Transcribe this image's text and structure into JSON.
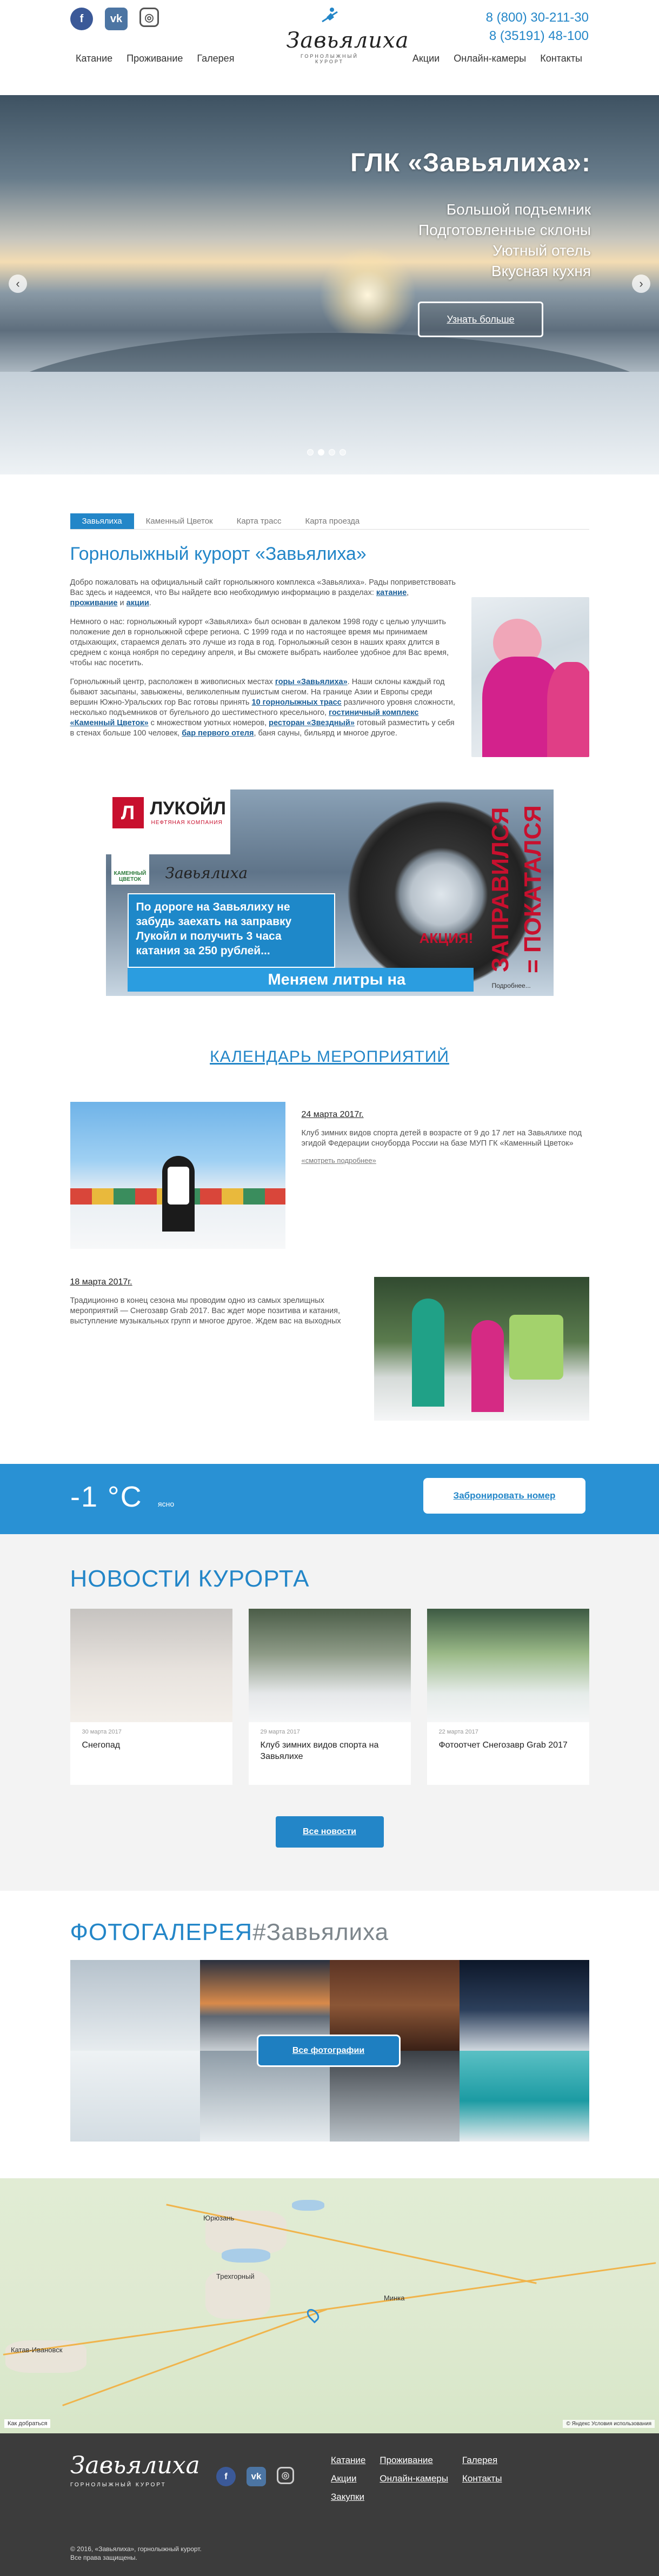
{
  "header": {
    "logo_word": "Завьялиха",
    "logo_sub": "горнолыжный курорт",
    "nav_left": [
      "Катание",
      "Проживание",
      "Галерея"
    ],
    "nav_right": [
      "Акции",
      "Онлайн-камеры",
      "Контакты"
    ],
    "phones": [
      "8 (800) 30-211-30",
      "8 (35191) 48-100"
    ],
    "socials": [
      {
        "name": "facebook-icon",
        "glyph": "f"
      },
      {
        "name": "vk-icon",
        "glyph": "vk"
      },
      {
        "name": "instagram-icon",
        "glyph": "◎"
      }
    ]
  },
  "slider": {
    "title": "ГЛК «Завьялиха»:",
    "lines": [
      "Большой подъемник",
      "Подготовленные склоны",
      "Уютный отель",
      "Вкусная кухня"
    ],
    "button": "Узнать больше",
    "prev": "‹",
    "next": "›",
    "slides_count": 4,
    "active": 1
  },
  "intro": {
    "tabs": [
      "Завьялиха",
      "Каменный Цветок",
      "Карта трасс",
      "Карта проезда"
    ],
    "title": "Горнолыжный курорт «Завьялиха»",
    "p1": "Добро пожаловать на официальный сайт горнолыжного комплекса «Завьялиха». Рады поприветствовать Вас здесь и надеемся, что Вы найдете всю необходимую информацию в разделах: ",
    "p1_links": [
      "катание",
      "проживание",
      "акции"
    ],
    "p2": "Немного о нас: горнолыжный курорт «Завьялиха» был основан в далеком 1998 году с целью улучшить положение дел в горнолыжной сфере региона. С 1999 года и по настоящее время мы принимаем отдыхающих, стараемся делать это лучше из года в год. Горнолыжный сезон в наших краях длится в среднем с конца ноября по середину апреля, и Вы сможете выбрать наиболее удобное для Вас время, чтобы нас посетить.",
    "p3a": "Горнолыжный центр, расположен в живописных местах ",
    "p3_link1": "горы «Завьялиха»",
    "p3b": ". Наши склоны каждый год бывают засыпаны, завьюжены, великолепным пушистым снегом. На границе Азии и Европы среди вершин Южно-Уральских гор Вас готовы принять ",
    "p3_link2": "10 горнолыжных трасс",
    "p3c": " различного уровня сложности, несколько подъемников от бугельного до шестиместного кресельного, ",
    "p3_link3": "гостиничный комплекс «Каменный Цветок»",
    "p3d": " с множеством уютных номеров, ",
    "p3_link4": "ресторан «Звездный»",
    "p3e": " готовый разместить у себя в стенах больше 100 человек, ",
    "p3_link5": "бар первого отеля",
    "p3f": ", баня сауны, бильярд и многое другое."
  },
  "banner": {
    "lukoil_logo": "Л",
    "lukoil_name": "ЛУКОЙЛ",
    "lukoil_sub": "НЕФТЯНАЯ КОМПАНИЯ",
    "kc": "КАМЕННЫЙ ЦВЕТОК",
    "brand": "Завьялиха",
    "box_text": "По дороге на Завьялиху не забудь заехать на заправку Лукойл и получить 3 часа катания за 250 рублей...",
    "strip": "Меняем литры на подъемы!",
    "akcia": "АКЦИЯ!",
    "vertical": "ЗАПРАВИЛСЯ = ПОКАТАЛСЯ",
    "more": "Подробнее..."
  },
  "calendar": {
    "title": "КАЛЕНДАРЬ МЕРОПРИЯТИЙ",
    "events": [
      {
        "date": "24 марта 2017г.",
        "text": "Клуб зимних видов спорта детей в возрасте от 9 до 17 лет на Завьялихе под эгидой Федерации сноуборда России на базе МУП ГК «Каменный Цветок»",
        "more": "«смотреть подробнее»"
      },
      {
        "date": "18 марта 2017г.",
        "text": "Традиционно в конец сезона мы проводим одно из самых зрелищных мероприятий — Снегозавр Grab 2017. Вас ждет море позитива и катания, выступление музыкальных групп и многое другое. Ждем вас на выходных"
      }
    ]
  },
  "weather": {
    "temp": "-1 °C",
    "cond": "ясно",
    "book": "Забронировать номер"
  },
  "news": {
    "title": "НОВОСТИ КУРОРТА",
    "items": [
      {
        "date": "30 марта 2017",
        "title": "Снегопад"
      },
      {
        "date": "29 марта 2017",
        "title": "Клуб зимних видов спорта на Завьялихе"
      },
      {
        "date": "22 марта 2017",
        "title": "Фотоотчет Снегозавр Grab 2017"
      }
    ],
    "button": "Все новости"
  },
  "gallery": {
    "title": "ФОТОГАЛЕРЕЯ",
    "tag": "#Завьялиха",
    "button": "Все фотографии"
  },
  "map": {
    "labels": [
      "Юрюзань",
      "Трехгорный",
      "Катав-Ивановск",
      "Минка"
    ],
    "yandex": "Как добраться",
    "copyright": "© Яндекс Условия использования"
  },
  "footer": {
    "logo_word": "Завьялиха",
    "logo_sub": "горнолыжный курорт",
    "nav": [
      "Катание",
      "Проживание",
      "Галерея",
      "Акции",
      "Онлайн-камеры",
      "Контакты",
      "Закупки"
    ],
    "copyright": [
      "© 2016, «Завьялиха», горнолыжный курорт.",
      "Все права защищены."
    ]
  },
  "colors": {
    "accent": "#2386c8",
    "footer_bg": "#3c3c3c",
    "weather_bg": "#2991d4"
  }
}
